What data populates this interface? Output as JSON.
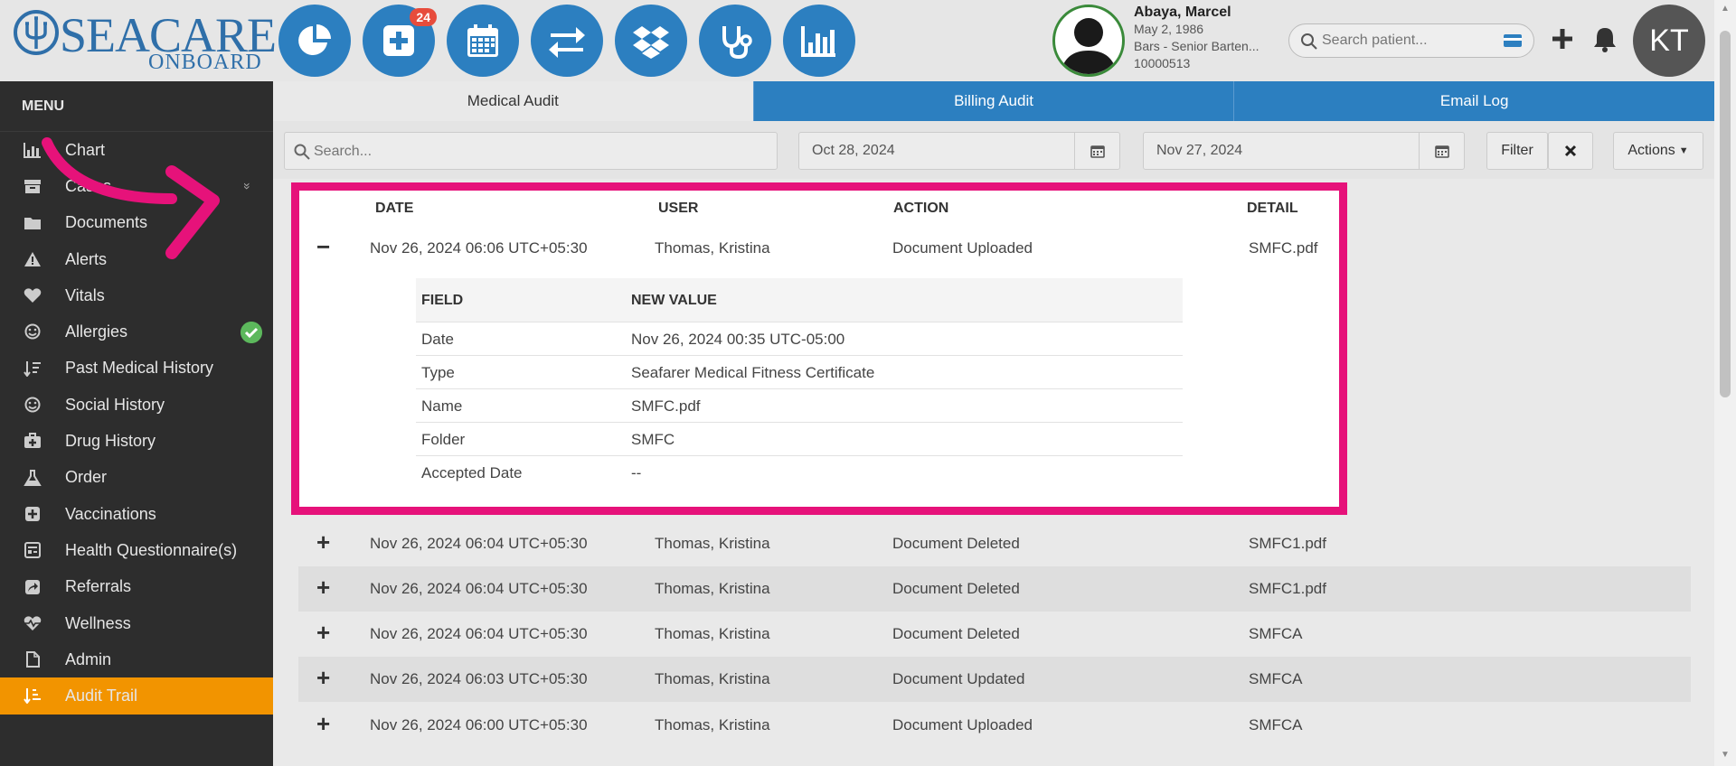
{
  "header": {
    "logo_word": "SEACARE",
    "logo_sub": "ONBOARD",
    "nav_buttons": [
      {
        "name": "dashboard",
        "icon": "pie-chart-icon"
      },
      {
        "name": "add-encounter",
        "icon": "medical-plus-icon",
        "badge": "24"
      },
      {
        "name": "calendar",
        "icon": "calendar-icon"
      },
      {
        "name": "transfer",
        "icon": "exchange-icon"
      },
      {
        "name": "dropbox",
        "icon": "dropbox-icon"
      },
      {
        "name": "stethoscope",
        "icon": "stethoscope-icon"
      },
      {
        "name": "reports",
        "icon": "bar-chart-icon"
      }
    ],
    "patient": {
      "name": "Abaya, Marcel",
      "dob": "May 2, 1986",
      "role": "Bars - Senior Barten...",
      "id": "10000513"
    },
    "search_placeholder": "Search patient...",
    "avatar_initials": "KT"
  },
  "sidebar": {
    "title": "MENU",
    "items": [
      {
        "label": "Chart",
        "icon": "chart-icon"
      },
      {
        "label": "Cases",
        "icon": "archive-icon",
        "chevron": "»"
      },
      {
        "label": "Documents",
        "icon": "folder-icon"
      },
      {
        "label": "Alerts",
        "icon": "warning-icon"
      },
      {
        "label": "Vitals",
        "icon": "heart-icon"
      },
      {
        "label": "Allergies",
        "icon": "smile-icon",
        "status": "check"
      },
      {
        "label": "Past Medical History",
        "icon": "sort-icon"
      },
      {
        "label": "Social History",
        "icon": "smile-icon"
      },
      {
        "label": "Drug History",
        "icon": "medkit-icon"
      },
      {
        "label": "Order",
        "icon": "flask-icon"
      },
      {
        "label": "Vaccinations",
        "icon": "plus-square-icon"
      },
      {
        "label": "Health Questionnaire(s)",
        "icon": "form-icon"
      },
      {
        "label": "Referrals",
        "icon": "share-icon"
      },
      {
        "label": "Wellness",
        "icon": "heartbeat-icon"
      },
      {
        "label": "Admin",
        "icon": "file-icon"
      },
      {
        "label": "Audit Trail",
        "icon": "sort-amount-icon",
        "active": true
      }
    ]
  },
  "tabs": [
    {
      "label": "Medical Audit",
      "active": true
    },
    {
      "label": "Billing Audit",
      "active": false
    },
    {
      "label": "Email Log",
      "active": false
    }
  ],
  "filters": {
    "search_placeholder": "Search...",
    "date_from": "Oct 28, 2024",
    "date_to": "Nov 27, 2024",
    "filter_label": "Filter",
    "actions_label": "Actions"
  },
  "table": {
    "headers": {
      "date": "DATE",
      "user": "USER",
      "action": "ACTION",
      "detail": "DETAIL"
    },
    "expanded": {
      "date": "Nov 26, 2024 06:06 UTC+05:30",
      "user": "Thomas, Kristina",
      "action": "Document Uploaded",
      "detail": "SMFC.pdf",
      "fields_header": {
        "field": "FIELD",
        "new_value": "NEW VALUE"
      },
      "fields": [
        {
          "field": "Date",
          "value": "Nov 26, 2024 00:35 UTC-05:00"
        },
        {
          "field": "Type",
          "value": "Seafarer Medical Fitness Certificate"
        },
        {
          "field": "Name",
          "value": "SMFC.pdf"
        },
        {
          "field": "Folder",
          "value": "SMFC"
        },
        {
          "field": "Accepted Date",
          "value": "--"
        }
      ]
    },
    "rows": [
      {
        "date": "Nov 26, 2024 06:04 UTC+05:30",
        "user": "Thomas, Kristina",
        "action": "Document Deleted",
        "detail": "SMFC1.pdf"
      },
      {
        "date": "Nov 26, 2024 06:04 UTC+05:30",
        "user": "Thomas, Kristina",
        "action": "Document Deleted",
        "detail": "SMFC1.pdf"
      },
      {
        "date": "Nov 26, 2024 06:04 UTC+05:30",
        "user": "Thomas, Kristina",
        "action": "Document Deleted",
        "detail": "SMFCA"
      },
      {
        "date": "Nov 26, 2024 06:03 UTC+05:30",
        "user": "Thomas, Kristina",
        "action": "Document Updated",
        "detail": "SMFCA"
      },
      {
        "date": "Nov 26, 2024 06:00 UTC+05:30",
        "user": "Thomas, Kristina",
        "action": "Document Uploaded",
        "detail": "SMFCA"
      }
    ]
  },
  "colors": {
    "brand_blue": "#2c7fc0",
    "sidebar_bg": "#2d2d2d",
    "active_orange": "#f29400",
    "highlight_pink": "#e6127a"
  }
}
